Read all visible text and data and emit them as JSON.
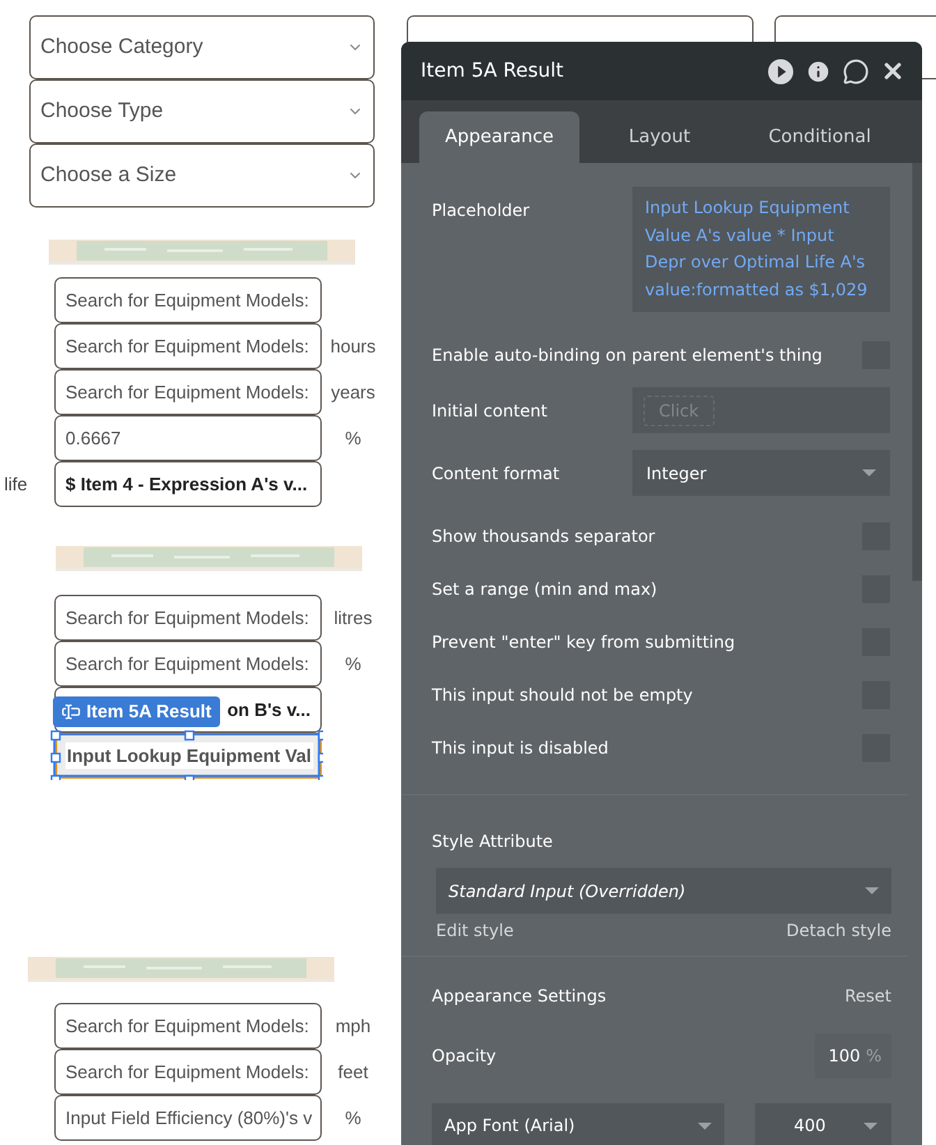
{
  "canvas": {
    "dropdowns": [
      {
        "placeholder": "Choose Category"
      },
      {
        "placeholder": "Choose Type"
      },
      {
        "placeholder": "Choose a Size"
      }
    ],
    "sections": [
      {
        "kind": "picture",
        "rows": [
          {
            "kind": "input",
            "value": "Search for Equipment Models:",
            "selected": false
          },
          {
            "kind": "input",
            "value": "Search for Equipment Models:",
            "unit": "hours",
            "selected": false
          },
          {
            "kind": "input",
            "value": "Search for Equipment Models:",
            "unit": "years",
            "selected": false
          },
          {
            "kind": "input",
            "value": "0.6667",
            "unit": "%",
            "selected": false
          },
          {
            "kind": "expression",
            "value": "$ Item 4 - Expression A's v...",
            "side_label": "life",
            "selected": false
          }
        ]
      },
      {
        "kind": "picture",
        "rows": [
          {
            "kind": "input",
            "value": "Search for Equipment Models:",
            "unit": "litres",
            "selected": false
          },
          {
            "kind": "input",
            "value": "Search for Equipment Models:",
            "unit": "%",
            "selected": false
          },
          {
            "kind": "expression",
            "value": "on B's v...",
            "selected": false
          },
          {
            "kind": "expression",
            "value": "Input Lookup Equipment Val",
            "selected": true,
            "badge": "Item 5A Result"
          }
        ]
      },
      {
        "kind": "picture",
        "rows": [
          {
            "kind": "input",
            "value": "Search for Equipment Models:",
            "unit": "mph",
            "selected": false
          },
          {
            "kind": "input",
            "value": "Search for Equipment Models:",
            "unit": "feet",
            "selected": false
          },
          {
            "kind": "input",
            "value": "Input Field Efficiency (80%)'s v",
            "unit": "%",
            "selected": false
          }
        ]
      }
    ]
  },
  "panel": {
    "title": "Item 5A Result",
    "tabs": [
      {
        "label": "Appearance",
        "selected": true
      },
      {
        "label": "Layout",
        "selected": false
      },
      {
        "label": "Conditional",
        "selected": false
      }
    ],
    "fields": [
      {
        "kind": "expression",
        "label": "Placeholder",
        "value": "Input Lookup Equipment Value A's value * Input Depr over Optimal Life A's value:formatted as $1,029"
      },
      {
        "kind": "checkbox",
        "label": "Enable auto-binding on parent element's thing",
        "checked": false
      },
      {
        "kind": "input",
        "label": "Initial content",
        "placeholder": "Click"
      },
      {
        "kind": "dropdown",
        "label": "Content format",
        "value": "Integer"
      },
      {
        "kind": "checkbox",
        "label": "Show thousands separator",
        "checked": false
      },
      {
        "kind": "checkbox",
        "label": "Set a range (min and max)",
        "checked": false
      },
      {
        "kind": "checkbox",
        "label": "Prevent \"enter\" key from submitting",
        "checked": false
      },
      {
        "kind": "checkbox",
        "label": "This input should not be empty",
        "checked": false
      },
      {
        "kind": "checkbox",
        "label": "This input is disabled",
        "checked": false
      }
    ],
    "style": {
      "label": "Style Attribute",
      "value": "Standard Input (Overridden)",
      "edit_link": "Edit style",
      "detach_link": "Detach style"
    },
    "appearance": {
      "title": "Appearance Settings",
      "reset": "Reset",
      "opacity_label": "Opacity",
      "opacity": "100",
      "opacity_unit": "%",
      "font": "App Font (Arial)",
      "weight": "400"
    }
  }
}
